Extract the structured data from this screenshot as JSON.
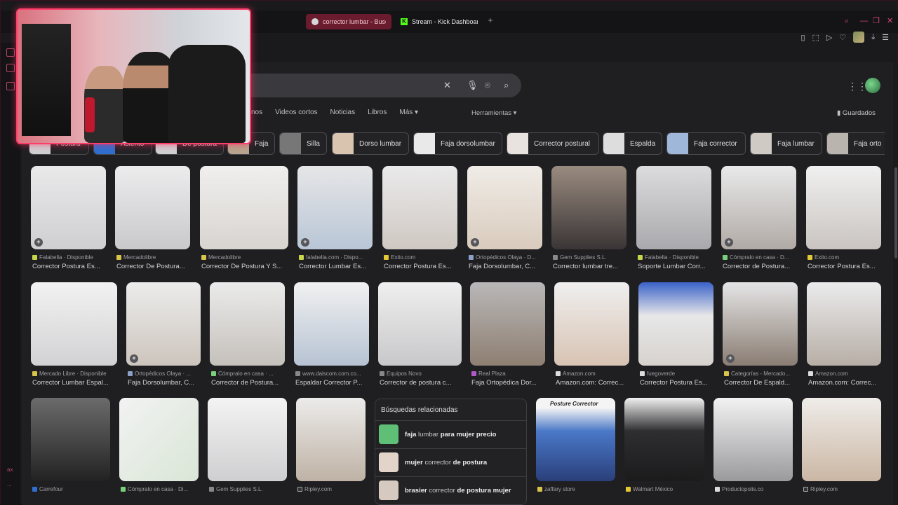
{
  "tabs": [
    {
      "label": "corrector lumbar - Busca"
    },
    {
      "label": "Stream - Kick Dashboard"
    }
  ],
  "window_controls": {
    "search": "⌕",
    "min": "—",
    "max": "❐",
    "close": "✕"
  },
  "sidebar": {
    "bottom_text": "ax",
    "more": "..."
  },
  "search": {
    "clear_icon": "✕",
    "mic_icon": "mic",
    "lens_icon": "lens",
    "search_icon": "search"
  },
  "filters": [
    "nos",
    "Videos cortos",
    "Noticias",
    "Libros",
    "Más ▾"
  ],
  "tools_label": "Herramientas ▾",
  "saved_label": "Guardados",
  "chips": [
    {
      "label": "Postura"
    },
    {
      "label": "Asiento"
    },
    {
      "label": "De postura"
    },
    {
      "label": "Faja"
    },
    {
      "label": "Silla"
    },
    {
      "label": "Dorso lumbar"
    },
    {
      "label": "Faja dorsolumbar"
    },
    {
      "label": "Corrector postural"
    },
    {
      "label": "Espalda"
    },
    {
      "label": "Faja corrector"
    },
    {
      "label": "Faja lumbar"
    },
    {
      "label": "Faja orto"
    }
  ],
  "row1": [
    {
      "source": "Falabella · Disponible",
      "title": "Corrector Postura Es..."
    },
    {
      "source": "Mercadolibre",
      "title": "Corrector De Postura..."
    },
    {
      "source": "Mercadolibre",
      "title": "Corrector De Postura Y S..."
    },
    {
      "source": "falabella.com · Dispo...",
      "title": "Corrector Lumbar Es..."
    },
    {
      "source": "Exito.com",
      "title": "Corrector Postura Es..."
    },
    {
      "source": "Ortopédicos Olaya · D...",
      "title": "Faja Dorsolumbar, C..."
    },
    {
      "source": "Gem Supplies S.L.",
      "title": "Corrector lumbar tre..."
    },
    {
      "source": "Falabella · Disponible",
      "title": "Soporte Lumbar Corr..."
    },
    {
      "source": "Cómpralo en casa · D...",
      "title": "Corrector de Postura..."
    },
    {
      "source": "Exito.com",
      "title": "Corrector Postura Es..."
    }
  ],
  "row2": [
    {
      "source": "Mercado Libre · Disponible",
      "title": "Corrector Lumbar Espal..."
    },
    {
      "source": "Ortopédicos Olaya · ...",
      "title": "Faja Dorsolumbar, C..."
    },
    {
      "source": "Cómpralo en casa · ...",
      "title": "Corrector de Postura..."
    },
    {
      "source": "www.daiscom.com.co...",
      "title": "Espaldar Corrector P..."
    },
    {
      "source": "Equipos Novo",
      "title": "Corrector de postura c..."
    },
    {
      "source": "Real Plaza",
      "title": "Faja Ortopédica Dor..."
    },
    {
      "source": "Amazon.com",
      "title": "Amazon.com: Correc..."
    },
    {
      "source": "fuegoverde",
      "title": "Corrector Postura Es..."
    },
    {
      "source": "Categorías - Mercado...",
      "title": "Corrector De Espald..."
    },
    {
      "source": "Amazon.com",
      "title": "Amazon.com: Correc..."
    }
  ],
  "row3": [
    {
      "source": "Carrefour"
    },
    {
      "source": "Cómpralo en casa · Di..."
    },
    {
      "source": "Gem Supplies S.L."
    },
    {
      "source": "Ripley.com"
    },
    {
      "source": "zaffary store"
    },
    {
      "source": "Walmart México"
    },
    {
      "source": "Productopolis.co"
    },
    {
      "source": "Ripley.com"
    }
  ],
  "row3_texts": {
    "posture_label": "Posture Corrector"
  },
  "related": {
    "header": "Búsquedas relacionadas",
    "items": [
      {
        "bold1": "faja",
        "plain": " lumbar ",
        "bold2": "para mujer precio"
      },
      {
        "bold1": "mujer",
        "plain": " corrector ",
        "bold2": "de postura"
      },
      {
        "bold1": "brasier",
        "plain": " corrector ",
        "bold2": "de postura mujer"
      }
    ]
  },
  "colors": {
    "accent": "#ff3d6a",
    "kick_green": "#53fc18"
  }
}
